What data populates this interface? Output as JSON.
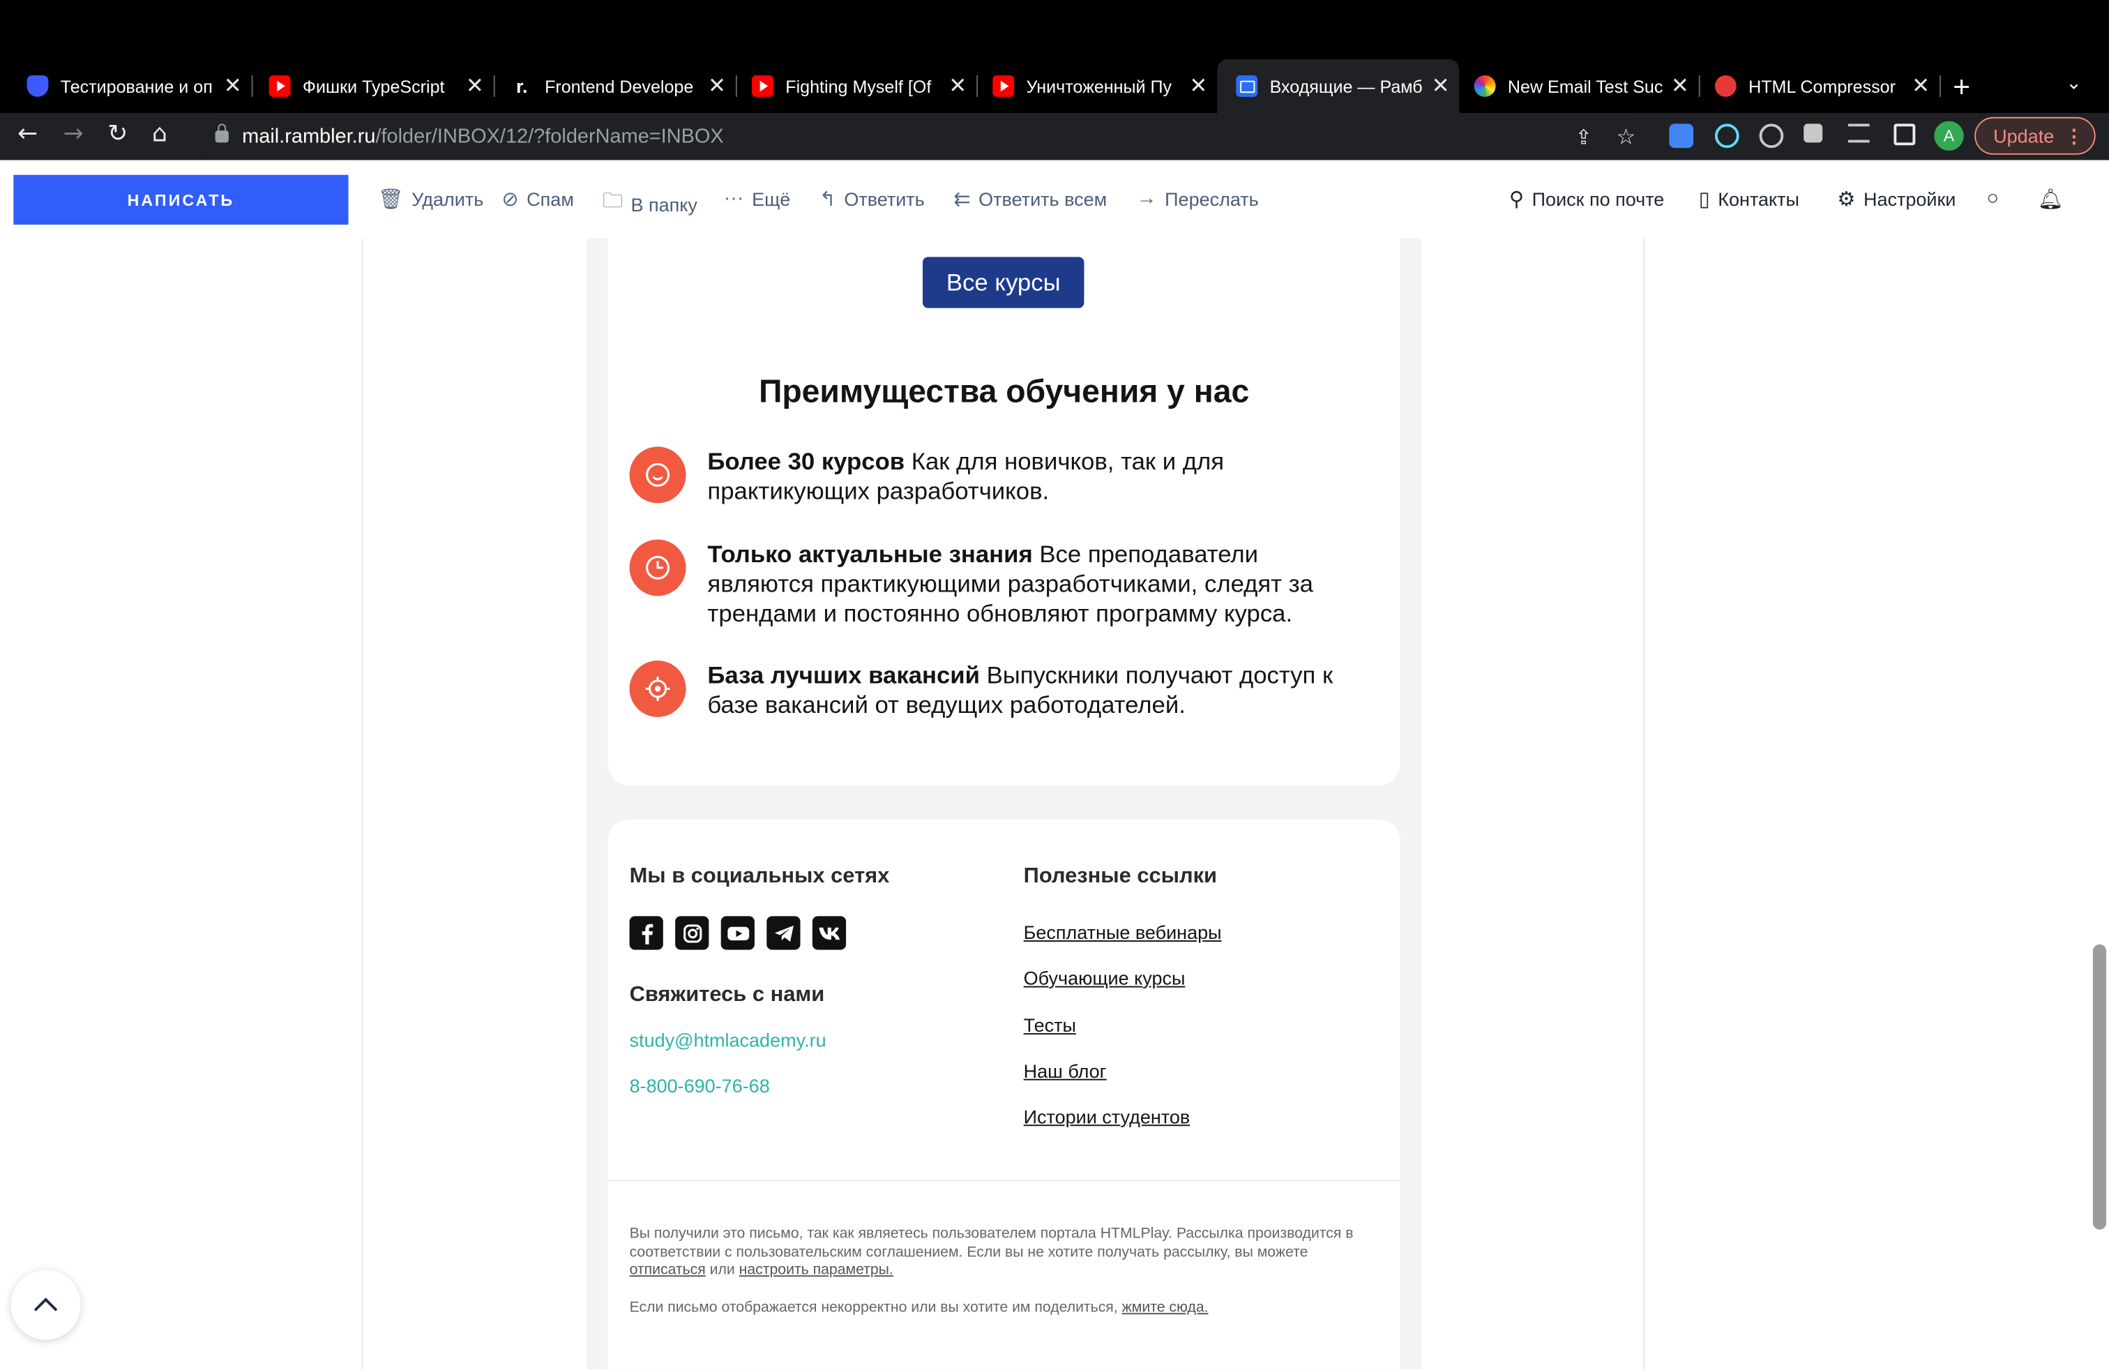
{
  "browser": {
    "tabs": [
      {
        "title": "Тестирование и оп",
        "icon": "shield-icon"
      },
      {
        "title": "Фишки TypeScript",
        "icon": "youtube-icon"
      },
      {
        "title": "Frontend Develope",
        "icon": "r-logo-icon"
      },
      {
        "title": "Fighting Myself [Of",
        "icon": "youtube-icon"
      },
      {
        "title": "Уничтоженный Пу",
        "icon": "youtube-icon"
      },
      {
        "title": "Входящие — Рамб",
        "icon": "mail-icon",
        "active": true
      },
      {
        "title": "New Email Test Suc",
        "icon": "flower-icon"
      },
      {
        "title": "HTML Compressor",
        "icon": "compressor-icon"
      }
    ],
    "url_host": "mail.rambler.ru",
    "url_path": "/folder/INBOX/12/?folderName=INBOX",
    "profile_initial": "A",
    "update_label": "Update"
  },
  "mail_toolbar": {
    "compose": "НАПИСАТЬ",
    "actions": [
      "Удалить",
      "Спам",
      "В папку",
      "Ещё",
      "Ответить",
      "Ответить всем",
      "Переслать"
    ],
    "search": "Поиск по почте",
    "contacts": "Контакты",
    "settings": "Настройки"
  },
  "email": {
    "all_courses_button": "Все курсы",
    "advantages_title": "Преимущества обучения у нас",
    "features": [
      {
        "bold": "Более 30 курсов",
        "text": " Как для новичков, так и для практикующих разработчиков.",
        "icon": "smile-icon"
      },
      {
        "bold": "Только актуальные знания",
        "text": " Все преподаватели являются практикующими разработчиками, следят за трендами и постоянно обновляют программу курса.",
        "icon": "clock-icon"
      },
      {
        "bold": "База лучших вакансий",
        "text": " Выпускники получают доступ к базе вакансий от ведущих работодателей.",
        "icon": "target-icon"
      }
    ],
    "footer": {
      "social_title": "Мы в социальных сетях",
      "social_icons": [
        "facebook-icon",
        "instagram-icon",
        "youtube-icon",
        "telegram-icon",
        "vk-icon"
      ],
      "contact_title": "Свяжитесь с нами",
      "email": "study@htmlacademy.ru",
      "phone": "8-800-690-76-68",
      "links_title": "Полезные ссылки",
      "links": [
        "Бесплатные вебинары",
        "Обучающие курсы",
        "Тесты",
        "Наш блог",
        "Истории студентов"
      ],
      "notice_text": "Вы получили это письмо, так как являетесь пользователем портала HTMLPlay. Рассылка производится в соответствии с пользовательским соглашением. Если вы не хотите получать рассылку, вы можете ",
      "unsubscribe": "отписаться",
      "notice_or": " или ",
      "configure": "настроить параметры.",
      "share_text": "Если письмо отображается некорректно или вы хотите им поделиться, ",
      "share_link": "жмите сюда."
    }
  },
  "colors": {
    "compose_blue": "#315efb",
    "courses_button": "#1e3a8a",
    "feature_icon": "#f15a41",
    "contact_teal": "#2bb5a3"
  }
}
